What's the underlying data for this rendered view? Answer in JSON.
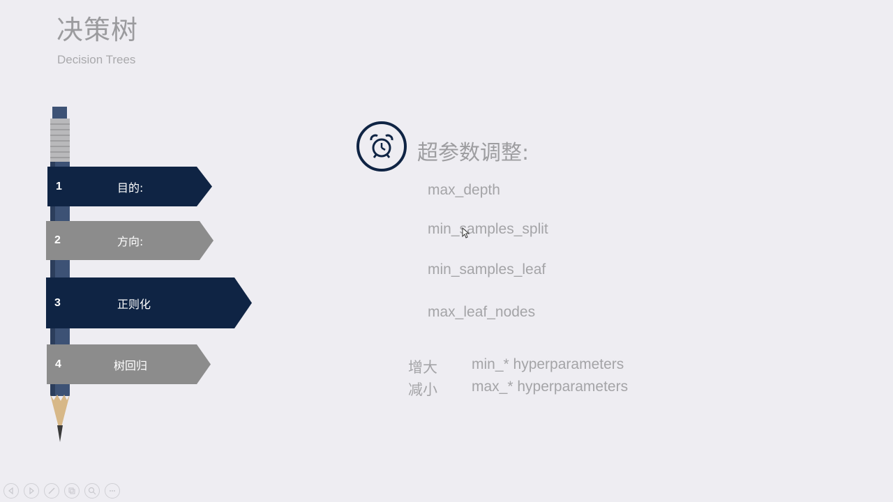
{
  "header": {
    "title": "决策树",
    "subtitle": "Decision Trees"
  },
  "menu": [
    {
      "number": "1",
      "label": "目的:"
    },
    {
      "number": "2",
      "label": "方向:"
    },
    {
      "number": "3",
      "label": "正则化"
    },
    {
      "number": "4",
      "label": "树回归"
    }
  ],
  "content": {
    "heading": "超参数调整:",
    "params": [
      "max_depth",
      "min_samples_split",
      "min_samples_leaf",
      "max_leaf_nodes"
    ],
    "notes": [
      {
        "cn": "增大",
        "en": "min_* hyperparameters"
      },
      {
        "cn": "减小",
        "en": "max_* hyperparameters"
      }
    ]
  },
  "colors": {
    "navy": "#0f2444",
    "gray_banner": "#8c8c8c",
    "background": "#eeedf2",
    "text_gray": "#a4a4a7"
  },
  "toolbar": {
    "icons": [
      "prev-icon",
      "next-icon",
      "pen-icon",
      "slides-icon",
      "zoom-icon",
      "more-icon"
    ]
  }
}
